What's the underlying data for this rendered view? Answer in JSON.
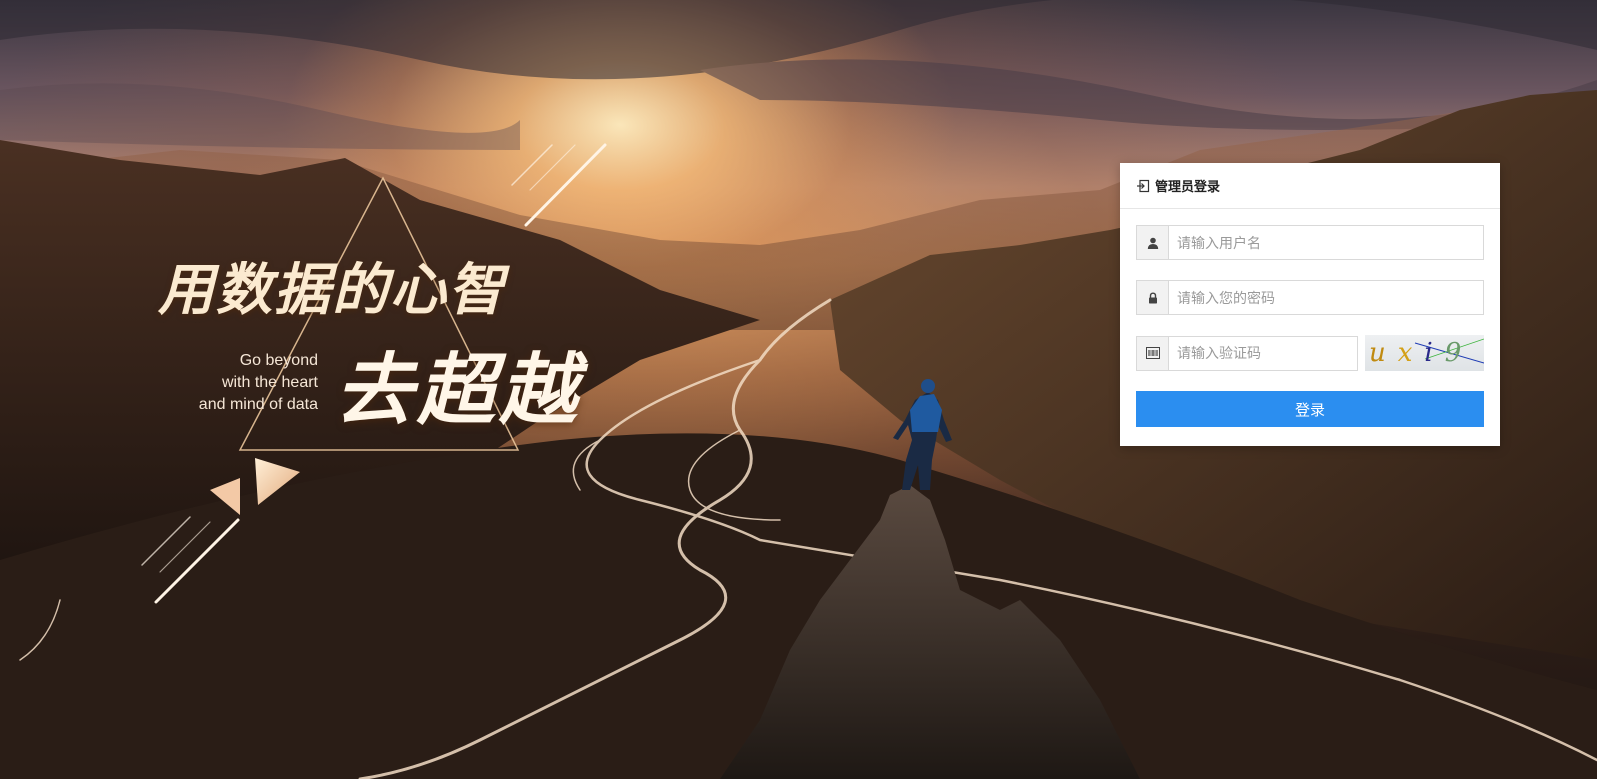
{
  "slogan": {
    "cn_line1": "用数据的心智",
    "cn_line2": "去超越",
    "en_lines": [
      "Go beyond",
      "with the heart",
      "and mind of data"
    ]
  },
  "login": {
    "title": "管理员登录",
    "username": {
      "placeholder": "请输入用户名",
      "value": ""
    },
    "password": {
      "placeholder": "请输入您的密码",
      "value": ""
    },
    "captcha": {
      "placeholder": "请输入验证码",
      "value": "",
      "code": "uxi9"
    },
    "submit_label": "登录"
  },
  "icons": {
    "header": "login-icon",
    "username": "user-icon",
    "password": "lock-icon",
    "captcha": "captcha-code-icon"
  },
  "colors": {
    "primary": "#2b8ef0",
    "panel_background": "#ffffff",
    "addon_background": "#f2f2f2"
  }
}
